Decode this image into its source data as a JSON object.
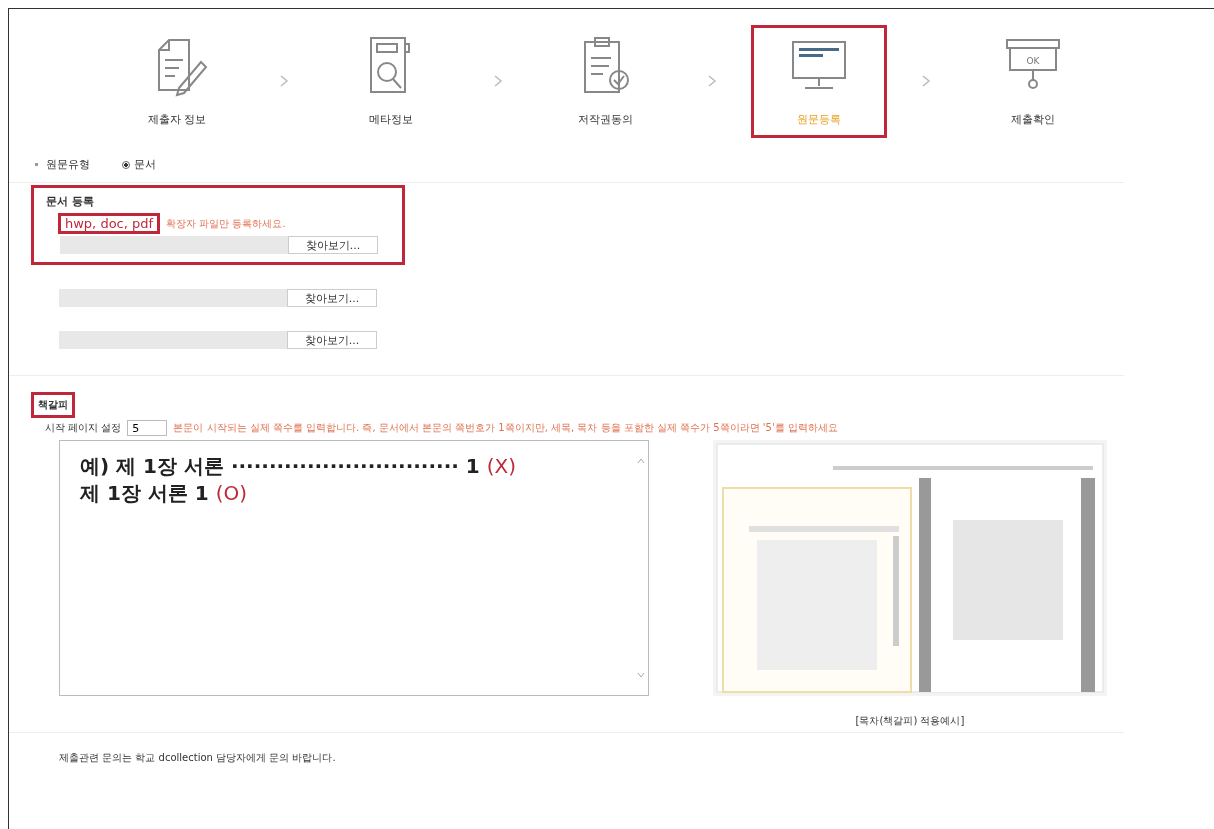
{
  "steps": [
    {
      "label": "제출자 정보",
      "kind": "writer",
      "selected": false
    },
    {
      "label": "메타정보",
      "kind": "meta",
      "selected": false
    },
    {
      "label": "저작권동의",
      "kind": "consent",
      "selected": false
    },
    {
      "label": "원문등록",
      "kind": "upload",
      "selected": true
    },
    {
      "label": "제출확인",
      "kind": "confirm",
      "icon_text": "OK",
      "selected": false
    }
  ],
  "type_row": {
    "label": "원문유형",
    "option": "문서",
    "selected": true
  },
  "document_section": {
    "title": "문서 등록",
    "highlighted": true,
    "extensions": "hwp, doc, pdf",
    "extensions_highlighted": true,
    "notice": "확장자 파일만 등록하세요.",
    "files": [
      {
        "button": "찾아보기..."
      },
      {
        "button": "찾아보기..."
      },
      {
        "button": "찾아보기..."
      }
    ]
  },
  "bookmark_section": {
    "title": "책갈피",
    "highlighted": true,
    "start_label": "시작 페이지 설정",
    "start_value": "5",
    "hint": "본문이 시작되는 실제 쪽수를 입력합니다. 즉, 문서에서 본문의 쪽번호가 1쪽이지만, 세목, 목차 등을 포함한 실제 쪽수가 5쪽이라면 '5'를 입력하세요",
    "examples": [
      {
        "text": "예) 제 1장 서론 ······························ 1",
        "mark": "(X)"
      },
      {
        "text": "제 1장 서론 1",
        "mark": "(O)"
      }
    ],
    "caption": "[목차(책갈피) 적용예시]"
  },
  "footer": "제출관련 문의는 학교 dcollection 담당자에게 문의 바랍니다."
}
